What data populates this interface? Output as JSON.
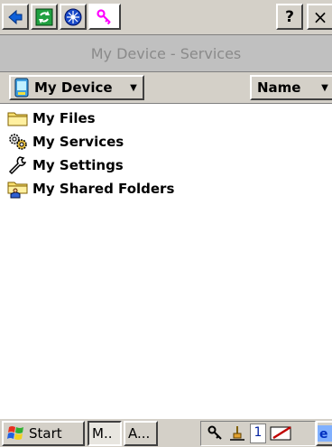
{
  "toolbar": {
    "help_label": "?",
    "close_label": "×",
    "icons": [
      "back-icon",
      "refresh-icon",
      "network-icon",
      "key-icon"
    ]
  },
  "title": "My Device - Services",
  "location": {
    "current": "My Device",
    "sort_by": "Name"
  },
  "items": [
    {
      "label": "My Files",
      "icon": "folder-icon"
    },
    {
      "label": "My Services",
      "icon": "gears-icon"
    },
    {
      "label": "My Settings",
      "icon": "wrench-icon"
    },
    {
      "label": "My Shared Folders",
      "icon": "shared-folder-icon"
    }
  ],
  "taskbar": {
    "start_label": "Start",
    "tasks": [
      "M..",
      "A..."
    ],
    "tray_number": "1"
  },
  "colors": {
    "chrome": "#d4d0c8",
    "title_band": "#c0c0c0",
    "title_text": "#8a8a8a",
    "highlight_pink": "#ff66ff"
  }
}
